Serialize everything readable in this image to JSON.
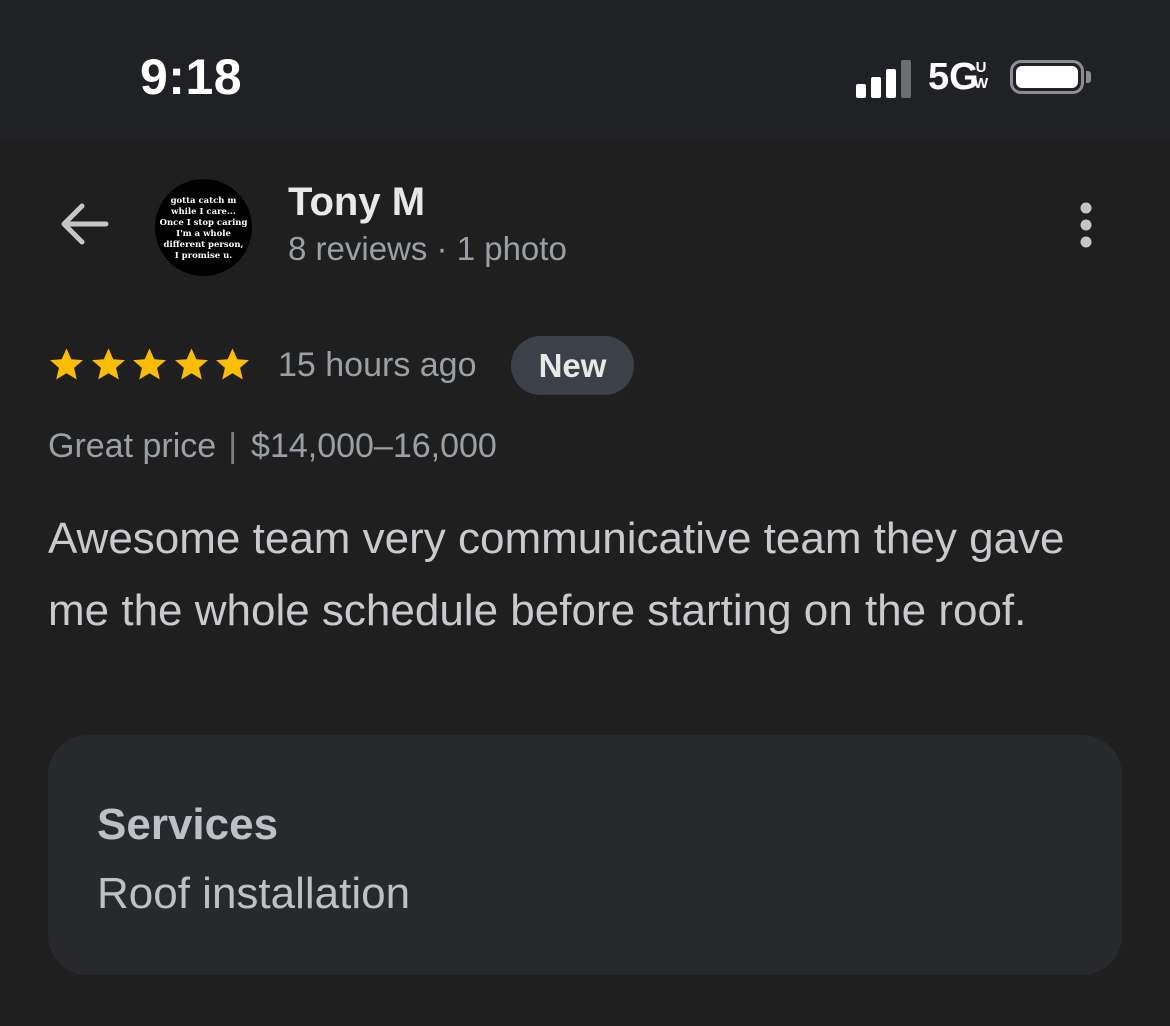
{
  "status_bar": {
    "time": "9:18",
    "network": "5G",
    "network_superscript": "U\nW"
  },
  "header": {
    "back_icon": "arrow-left-icon",
    "avatar_text": "gotta catch m\nwhile I care...\nOnce I stop caring\nI'm a whole\ndifferent person,\nI promise u.",
    "reviewer_name": "Tony M",
    "reviewer_meta": "8 reviews · 1 photo",
    "more_icon": "more-vertical-icon"
  },
  "review": {
    "rating": 5,
    "rating_max": 5,
    "star_color": "#fbbc04",
    "time_ago": "15 hours ago",
    "badge": "New",
    "price_label": "Great price",
    "price_separator": "|",
    "price_range": "$14,000–16,000",
    "text": "Awesome team very communicative team they gave me the whole schedule before starting on the roof."
  },
  "services": {
    "title": "Services",
    "value": "Roof installation"
  }
}
